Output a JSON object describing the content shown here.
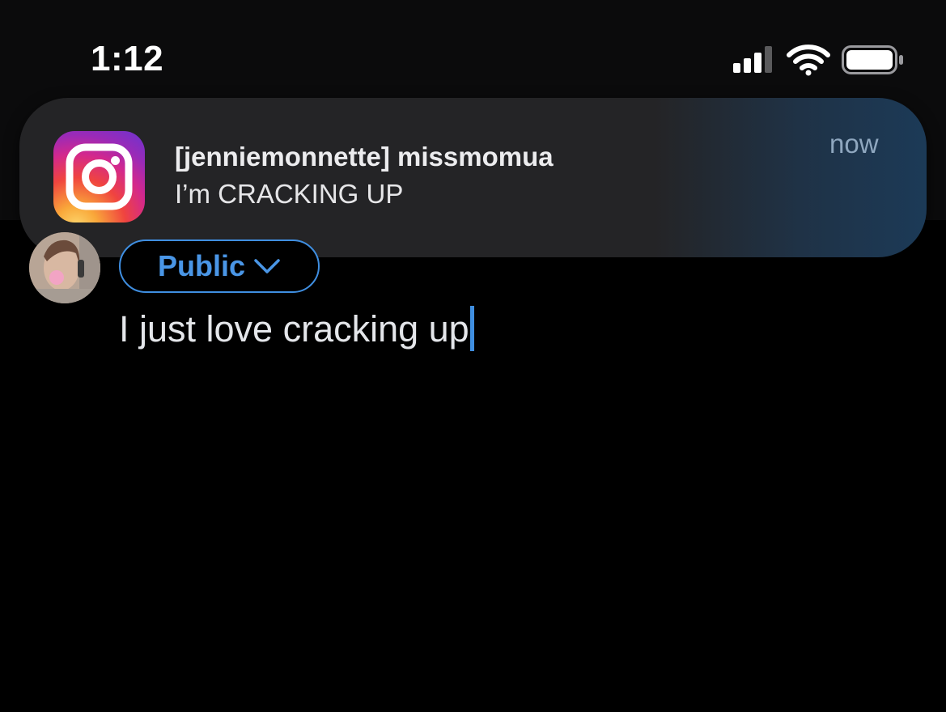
{
  "status_bar": {
    "time": "1:12",
    "signal_icon": "cellular-signal-icon",
    "wifi_icon": "wifi-icon",
    "battery_icon": "battery-icon"
  },
  "notification": {
    "app_icon": "instagram-icon",
    "title": "[jenniemonnette] missmomua",
    "body": "I’m CRACKING UP",
    "time": "now"
  },
  "compose": {
    "audience_label": "Public",
    "audience_icon": "chevron-down-icon",
    "text": "I just love cracking up"
  },
  "colors": {
    "background": "#000000",
    "accent": "#3f8ee0",
    "notification_bg": "#242426",
    "notification_time": "#8fa7bf"
  }
}
